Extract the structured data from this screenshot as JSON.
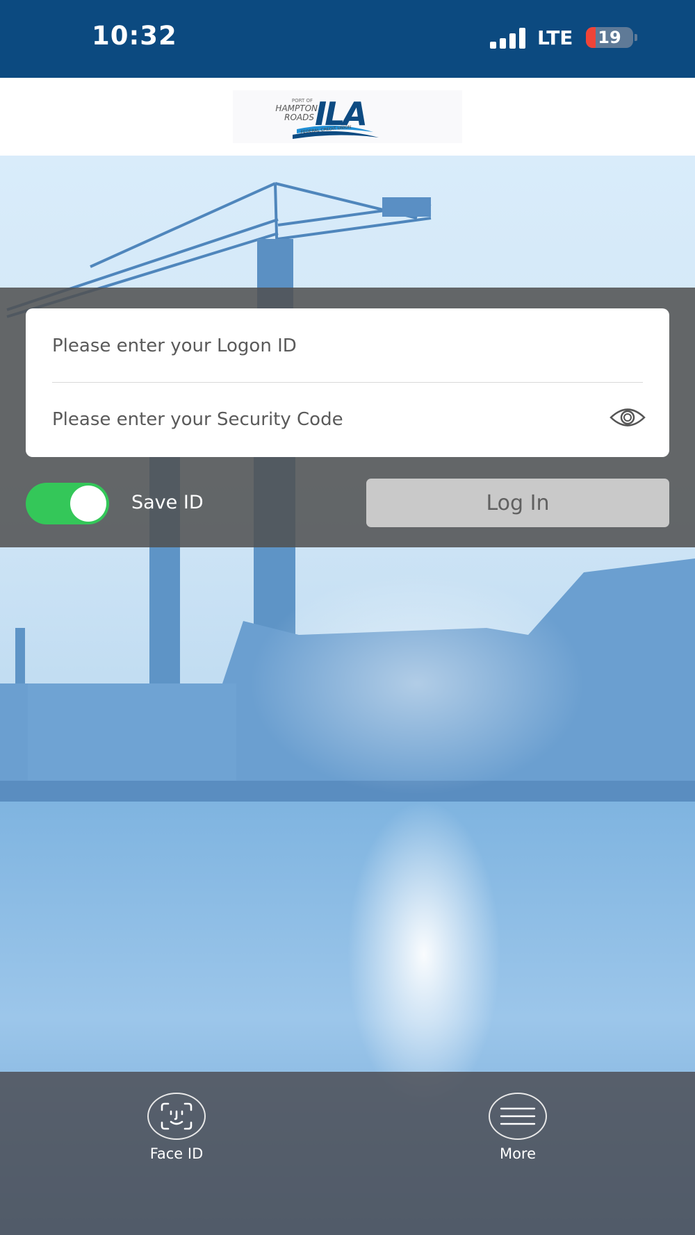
{
  "status_bar": {
    "time": "10:32",
    "network": "LTE",
    "battery_level": "19",
    "battery_color": "#f04438"
  },
  "header": {
    "logo_icon": "ila-credit-union-logo",
    "logo_text": {
      "port_of": "PORT OF",
      "hampton": "HAMPTON",
      "roads": "ROADS",
      "ila": "ILA",
      "fcu": "FEDERAL CREDIT UNION"
    }
  },
  "login": {
    "logon_placeholder": "Please enter your Logon ID",
    "security_placeholder": "Please enter your Security Code",
    "save_id_label": "Save ID",
    "save_id_on": true,
    "login_label": "Log In"
  },
  "bottom_bar": {
    "face_id_label": "Face ID",
    "more_label": "More"
  },
  "colors": {
    "status_bar": "#0c4a80",
    "toggle_on": "#34c759",
    "login_button": "#c9c9c9"
  }
}
